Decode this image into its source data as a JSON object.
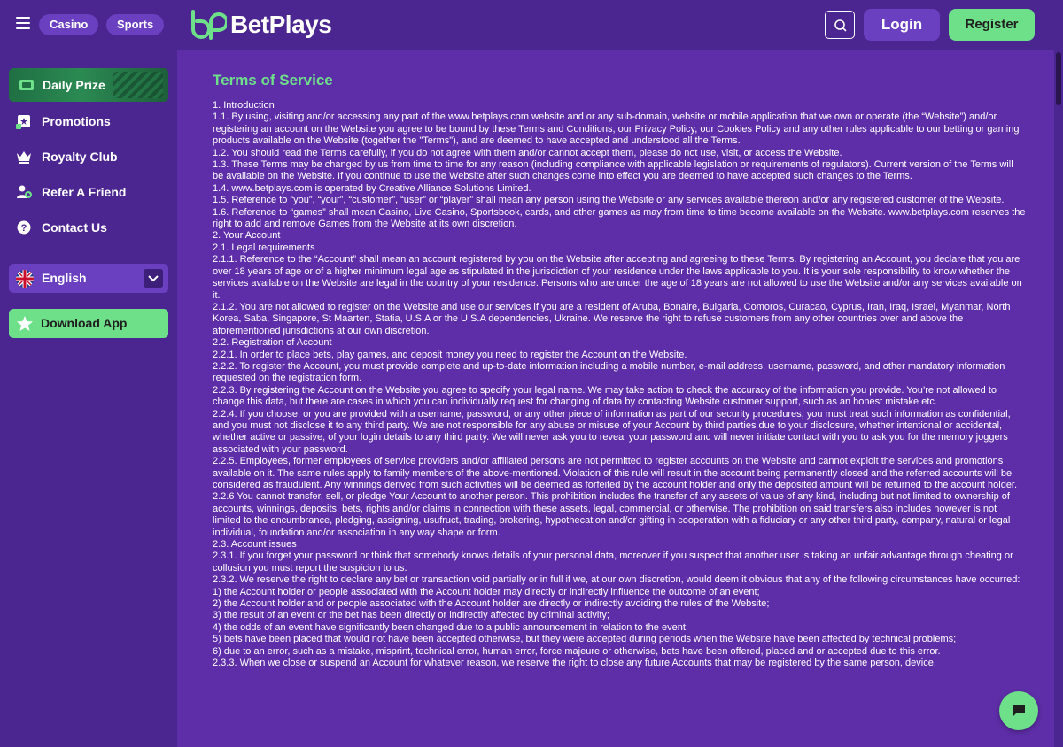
{
  "header": {
    "casino_label": "Casino",
    "sports_label": "Sports",
    "brand": "BetPlays",
    "login_label": "Login",
    "register_label": "Register"
  },
  "sidebar": {
    "daily_prize": "Daily Prize",
    "items": [
      {
        "label": "Promotions",
        "icon": "gift-icon"
      },
      {
        "label": "Royalty Club",
        "icon": "crown-icon"
      },
      {
        "label": "Refer A Friend",
        "icon": "users-icon"
      },
      {
        "label": "Contact Us",
        "icon": "question-icon"
      }
    ],
    "language": "English",
    "download_label": "Download App"
  },
  "main": {
    "title": "Terms of Service",
    "paragraphs": [
      "1. Introduction",
      "1.1. By using, visiting and/or accessing any part of the www.betplays.com website and or any sub-domain, website or mobile application that we own or operate (the “Website”) and/or registering an account on the Website you agree to be bound by these Terms and Conditions, our Privacy Policy, our Cookies Policy and any other rules applicable to our betting or gaming products available on the Website (together the \"Terms\"), and are deemed to have accepted and understood all the Terms.",
      "1.2. You should read the Terms carefully, if you do not agree with them and/or cannot accept them, please do not use, visit, or access the Website.",
      "1.3. These Terms may be changed by us from time to time for any reason (including compliance with applicable legislation or requirements of regulators). Current version of the Terms will be available on the Website. If you continue to use the Website after such changes come into effect you are deemed to have accepted such changes to the Terms.",
      "1.4. www.betplays.com is operated by Creative Alliance Solutions Limited.",
      "1.5. Reference to “you”, “your”, “customer”, “user” or “player” shall mean any person using the Website or any services available thereon and/or any registered customer of the Website.",
      "1.6. Reference to “games” shall mean Casino, Live Casino, Sportsbook, cards, and other games as may from time to time become available on the Website. www.betplays.com reserves the right to add and remove Games from the Website at its own discretion.",
      "2. Your Account",
      "2.1. Legal requirements",
      "2.1.1. Reference to the “Account” shall mean an account registered by you on the Website after accepting and agreeing to these Terms. By registering an Account, you declare that you are over 18 years of age or of a higher minimum legal age as stipulated in the jurisdiction of your residence under the laws applicable to you. It is your sole responsibility to know whether the services available on the Website are legal in the country of your residence. Persons who are under the age of 18 years are not allowed to use the Website and/or any services available on it.",
      "2.1.2. You are not allowed to register on the Website and use our services if you are a resident of Aruba, Bonaire, Bulgaria, Comoros, Curacao, Cyprus, Iran, Iraq, Israel, Myanmar, North Korea, Saba, Singapore, St Maarten, Statia, U.S.A or the U.S.A dependencies, Ukraine. We reserve the right to refuse customers from any other countries over and above the aforementioned jurisdictions at our own discretion.",
      "2.2. Registration of Account",
      "2.2.1. In order to place bets, play games, and deposit money you need to register the Account on the Website.",
      "2.2.2. To register the Account, you must provide complete and up-to-date information including a mobile number, e-mail address, username, password, and other mandatory information requested on the registration form.",
      "2.2.3. By registering the Account on the Website you agree to specify your legal name. We may take action to check the accuracy of the information you provide. You’re not allowed to change this data, but there are cases in which you can individually request for changing of data by contacting Website customer support, such as an honest mistake etc.",
      "2.2.4. If you choose, or you are provided with a username, password, or any other piece of information as part of our security procedures, you must treat such information as confidential, and you must not disclose it to any third party. We are not responsible for any abuse or misuse of your Account by third parties due to your disclosure, whether intentional or accidental, whether active or passive, of your login details to any third party. We will never ask you to reveal your password and will never initiate contact with you to ask you for the memory joggers associated with your password.",
      "2.2.5. Employees, former employees of service providers and/or affiliated persons are not permitted to register accounts on the Website and cannot exploit the services and promotions available on it. The same rules apply to family members of the above-mentioned. Violation of this rule will result in the account being permanently closed and the referred accounts will be considered as fraudulent. Any winnings derived from such activities will be deemed as forfeited by the account holder and only the deposited amount will be returned to the account holder.",
      "2.2.6 You cannot transfer, sell, or pledge Your Account to another person. This prohibition includes the transfer of any assets of value of any kind, including but not limited to ownership of accounts, winnings, deposits, bets, rights and/or claims in connection with these assets, legal, commercial, or otherwise. The prohibition on said transfers also includes however is not limited to the encumbrance, pledging, assigning, usufruct, trading, brokering, hypothecation and/or gifting in cooperation with a fiduciary or any other third party, company, natural or legal individual, foundation and/or association in any way shape or form.",
      "2.3. Account issues",
      "2.3.1. If you forget your password or think that somebody knows details of your personal data, moreover if you suspect that another user is taking an unfair advantage through cheating or collusion you must report the suspicion to us.",
      "2.3.2. We reserve the right to declare any bet or transaction void partially or in full if we, at our own discretion, would deem it obvious that any of the following circumstances have occurred:",
      "1) the Account holder or people associated with the Account holder may directly or indirectly influence the outcome of an event;",
      "2) the Account holder and or people associated with the Account holder are directly or indirectly avoiding the rules of the Website;",
      "3) the result of an event or the bet has been directly or indirectly affected by criminal activity;",
      "4) the odds of an event have significantly been changed due to a public announcement in relation to the event;",
      "5) bets have been placed that would not have been accepted otherwise, but they were accepted during periods when the Website have been affected by technical problems;",
      "6) due to an error, such as a mistake, misprint, technical error, human error, force majeure or otherwise, bets have been offered, placed and or accepted due to this error.",
      "2.3.3. When we close or suspend an Account for whatever reason, we reserve the right to close any future Accounts that may be registered by the same person, device,"
    ]
  },
  "colors": {
    "header_bg": "#4b2590",
    "content_bg": "#5e2ea8",
    "accent_green": "#6ee08a",
    "pill_purple": "#6a3fc0"
  }
}
